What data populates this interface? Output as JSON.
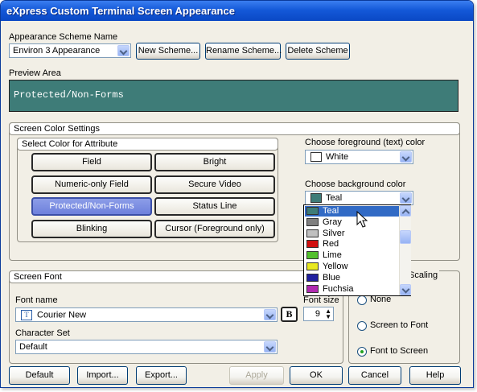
{
  "window": {
    "title": "eXpress Custom Terminal Screen Appearance"
  },
  "scheme": {
    "label": "Appearance Scheme Name",
    "selected": "Environ 3 Appearance",
    "new_label": "New Scheme...",
    "rename_label": "Rename Scheme...",
    "delete_label": "Delete Scheme"
  },
  "preview": {
    "label": "Preview Area",
    "text": "Protected/Non-Forms",
    "bg_color": "#3e7c78",
    "fg_color": "#ffffff"
  },
  "color_settings": {
    "group_label": "Screen Color Settings",
    "attr_group_label": "Select Color for Attribute",
    "attributes": [
      "Field",
      "Bright",
      "Numeric-only Field",
      "Secure Video",
      "Protected/Non-Forms",
      "Status Line",
      "Blinking",
      "Cursor (Foreground only)"
    ],
    "selected_attribute": "Protected/Non-Forms",
    "fg_label": "Choose foreground (text) color",
    "fg_selected": "White",
    "fg_swatch": "#ffffff",
    "bg_label": "Choose background color",
    "bg_selected": "Teal",
    "bg_swatch": "#3e7c78",
    "bg_options": [
      {
        "name": "Teal",
        "color": "#3e7c78"
      },
      {
        "name": "Gray",
        "color": "#808080"
      },
      {
        "name": "Silver",
        "color": "#c0c0c0"
      },
      {
        "name": "Red",
        "color": "#d01010"
      },
      {
        "name": "Lime",
        "color": "#52bf2c"
      },
      {
        "name": "Yellow",
        "color": "#e8e820"
      },
      {
        "name": "Blue",
        "color": "#2020a0"
      },
      {
        "name": "Fuchsia",
        "color": "#b02ab0"
      }
    ]
  },
  "font": {
    "group_label": "Screen Font",
    "name_label": "Font name",
    "name_value": "Courier New",
    "font_icon": "truetype-font-icon",
    "bold_label": "B",
    "size_label": "Font size",
    "size_value": "9",
    "charset_label": "Character Set",
    "charset_value": "Default"
  },
  "scaling": {
    "group_label": "Scaling",
    "options": [
      "None",
      "Screen to Font",
      "Font to Screen"
    ],
    "selected": "Font to Screen"
  },
  "footer": {
    "default_label": "Default",
    "import_label": "Import...",
    "export_label": "Export...",
    "apply_label": "Apply",
    "ok_label": "OK",
    "cancel_label": "Cancel",
    "help_label": "Help"
  }
}
